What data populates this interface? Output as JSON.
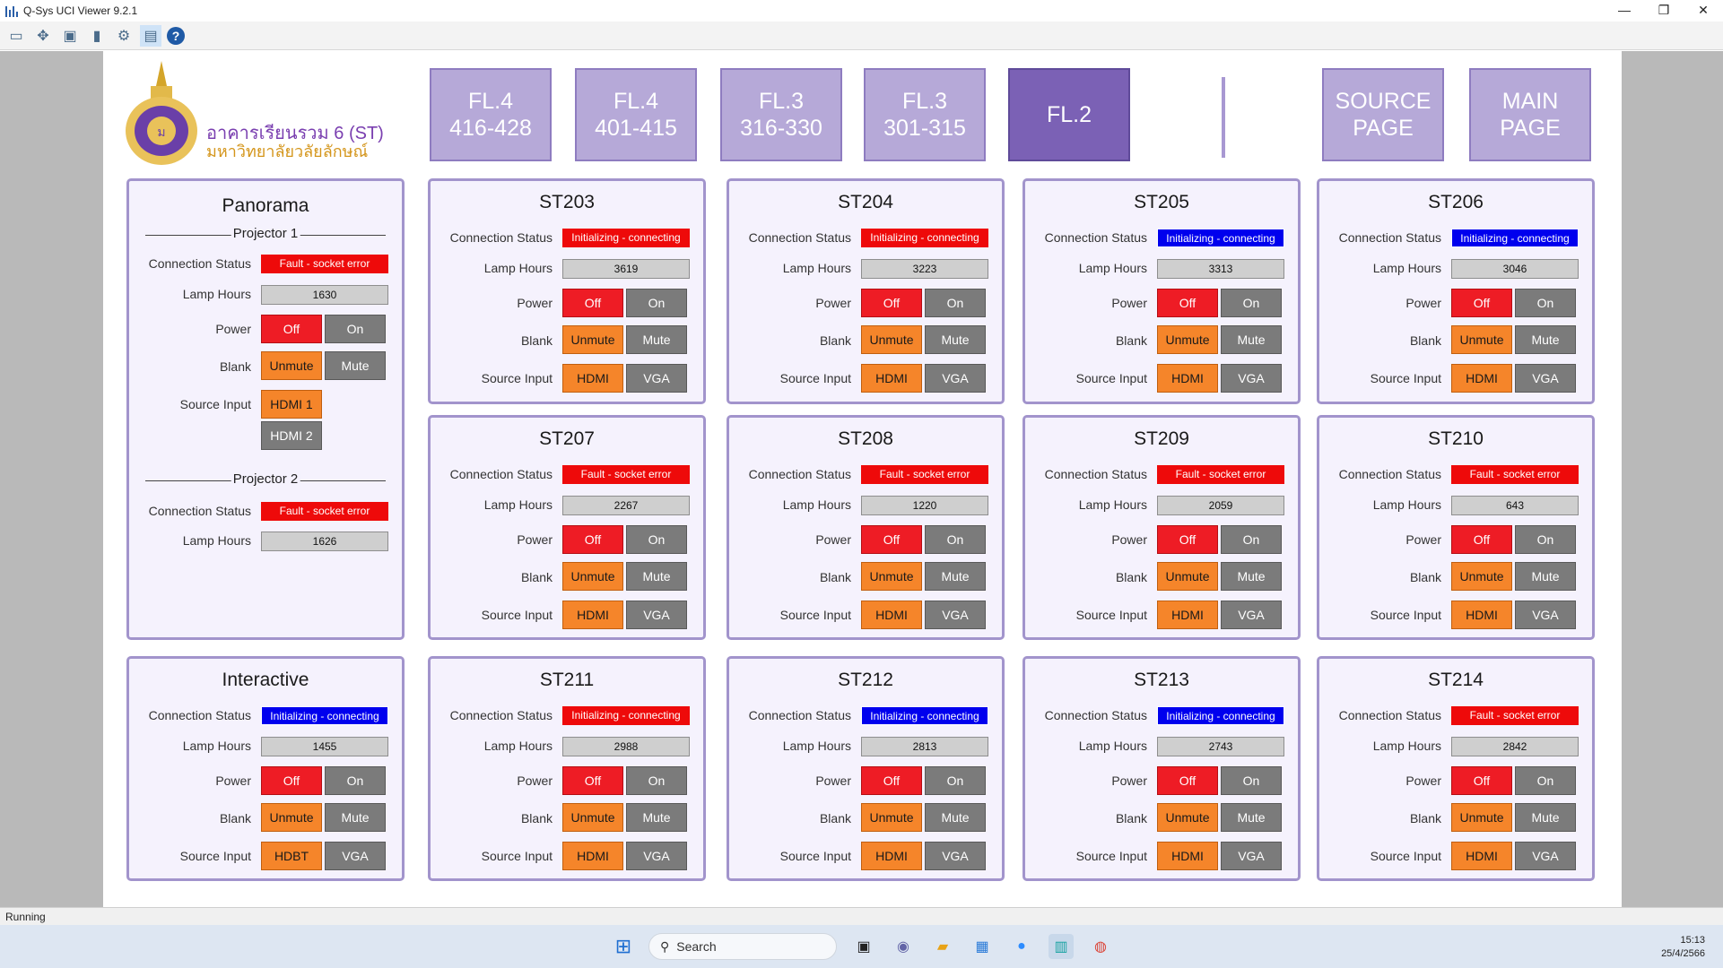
{
  "window": {
    "title": "Q-Sys UCI Viewer 9.2.1",
    "minimize": "—",
    "maximize": "❐",
    "close": "✕"
  },
  "toolbar": {
    "icons": [
      "panel-icon",
      "fit-icon",
      "image-icon",
      "book-icon",
      "settings-icon",
      "keyboard-icon",
      "help-icon"
    ],
    "help_label": "?"
  },
  "header": {
    "logo_line1": "อาคารเรียนรวม 6 (ST)",
    "logo_line2": "มหาวิทยาลัยวลัยลักษณ์"
  },
  "nav": [
    {
      "label": "FL.4\n416-428",
      "active": false
    },
    {
      "label": "FL.4\n401-415",
      "active": false
    },
    {
      "label": "FL.3\n316-330",
      "active": false
    },
    {
      "label": "FL.3\n301-315",
      "active": false
    },
    {
      "label": "FL.2",
      "active": true
    },
    {
      "label": "SOURCE\nPAGE",
      "active": false
    },
    {
      "label": "MAIN\nPAGE",
      "active": false
    }
  ],
  "labels": {
    "connection": "Connection Status",
    "lamp": "Lamp Hours",
    "power": "Power",
    "blank": "Blank",
    "source": "Source Input",
    "off": "Off",
    "on": "On",
    "unmute": "Unmute",
    "mute": "Mute"
  },
  "colors": {
    "status_blue": "#0000ee",
    "status_red": "#ee0a0a",
    "off_red": "#ee1c25",
    "unmute_orange": "#f5852a",
    "panel_border": "#a294cc",
    "nav_active": "#7b61b5"
  },
  "panorama": {
    "title": "Panorama",
    "projector1": {
      "header": "Projector 1",
      "status": "Fault - socket error",
      "lamp": "1630",
      "src1": "HDMI 1",
      "src2": "HDMI 2"
    },
    "projector2": {
      "header": "Projector 2",
      "status": "Fault - socket error",
      "lamp": "1626"
    }
  },
  "rooms": [
    {
      "name": "ST203",
      "status": "Initializing - connecting",
      "status_color": "red",
      "lamp": "3619",
      "src1": "HDMI",
      "src2": "VGA"
    },
    {
      "name": "ST204",
      "status": "Initializing - connecting",
      "status_color": "red",
      "lamp": "3223",
      "src1": "HDMI",
      "src2": "VGA"
    },
    {
      "name": "ST205",
      "status": "Initializing - connecting",
      "status_color": "blue",
      "lamp": "3313",
      "src1": "HDMI",
      "src2": "VGA"
    },
    {
      "name": "ST206",
      "status": "Initializing - connecting",
      "status_color": "blue",
      "lamp": "3046",
      "src1": "HDMI",
      "src2": "VGA"
    },
    {
      "name": "ST207",
      "status": "Fault - socket error",
      "status_color": "red",
      "lamp": "2267",
      "src1": "HDMI",
      "src2": "VGA"
    },
    {
      "name": "ST208",
      "status": "Fault - socket error",
      "status_color": "red",
      "lamp": "1220",
      "src1": "HDMI",
      "src2": "VGA"
    },
    {
      "name": "ST209",
      "status": "Fault - socket error",
      "status_color": "red",
      "lamp": "2059",
      "src1": "HDMI",
      "src2": "VGA"
    },
    {
      "name": "ST210",
      "status": "Fault - socket error",
      "status_color": "red",
      "lamp": "643",
      "src1": "HDMI",
      "src2": "VGA"
    },
    {
      "name": "Interactive",
      "status": "Initializing - connecting",
      "status_color": "blue",
      "lamp": "1455",
      "src1": "HDBT",
      "src2": "VGA"
    },
    {
      "name": "ST211",
      "status": "Initializing - connecting",
      "status_color": "red",
      "lamp": "2988",
      "src1": "HDMI",
      "src2": "VGA"
    },
    {
      "name": "ST212",
      "status": "Initializing - connecting",
      "status_color": "blue",
      "lamp": "2813",
      "src1": "HDMI",
      "src2": "VGA"
    },
    {
      "name": "ST213",
      "status": "Initializing - connecting",
      "status_color": "blue",
      "lamp": "2743",
      "src1": "HDMI",
      "src2": "VGA"
    },
    {
      "name": "ST214",
      "status": "Fault - socket error",
      "status_color": "red",
      "lamp": "2842",
      "src1": "HDMI",
      "src2": "VGA"
    }
  ],
  "statusbar": {
    "text": "Running"
  },
  "taskbar": {
    "search_placeholder": "Search",
    "time": "15:13",
    "date": "25/4/2566"
  }
}
